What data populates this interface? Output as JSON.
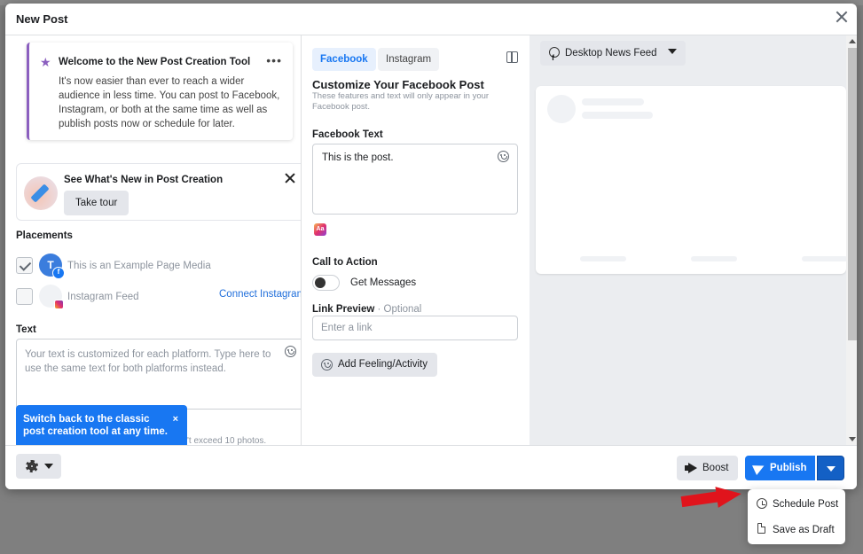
{
  "modal": {
    "title": "New Post"
  },
  "welcome": {
    "title": "Welcome to the New Post Creation Tool",
    "body": "It's now easier than ever to reach a wider audience in less time. You can post to Facebook, Instagram, or both at the same time as well as publish posts now or schedule for later."
  },
  "whats_new": {
    "title": "See What's New in Post Creation",
    "button": "Take tour"
  },
  "placements": {
    "label": "Placements",
    "items": [
      {
        "label": "This is an Example Page Media",
        "checked": true,
        "avatar_letter": "T"
      },
      {
        "label": "Instagram Feed",
        "checked": false,
        "link": "Connect Instagram"
      }
    ]
  },
  "text_section": {
    "label": "Text",
    "placeholder": "Your text is customized for each platform. Type here to use the same text for both platforms instead."
  },
  "tooltip": {
    "text": "Switch back to the classic post creation tool at any time.",
    "close": "×"
  },
  "faded_note": "'t exceed 10 photos.",
  "tabs": {
    "facebook": "Facebook",
    "instagram": "Instagram"
  },
  "customize": {
    "title": "Customize Your Facebook Post",
    "subtitle": "These features and text will only appear in your Facebook post."
  },
  "facebook_text": {
    "label": "Facebook Text",
    "value": "This is the post."
  },
  "cta": {
    "label": "Call to Action",
    "toggle_label": "Get Messages"
  },
  "link_preview": {
    "label": "Link Preview",
    "optional": " · Optional",
    "placeholder": "Enter a link"
  },
  "feeling": {
    "label": "Add Feeling/Activity"
  },
  "preview": {
    "dropdown": "Desktop News Feed"
  },
  "footer": {
    "boost": "Boost",
    "publish": "Publish"
  },
  "publish_menu": {
    "items": [
      "Schedule Post",
      "Save as Draft"
    ]
  },
  "colors": {
    "primary": "#1877f2",
    "accent_purple": "#8b5fbf",
    "arrow_red": "#e0141c"
  },
  "icons": [
    "star-icon",
    "more-icon",
    "close-icon",
    "split-view-icon",
    "smile-icon",
    "text-format-icon",
    "globe-icon",
    "gear-icon",
    "megaphone-icon",
    "send-icon",
    "clock-icon",
    "document-icon"
  ]
}
